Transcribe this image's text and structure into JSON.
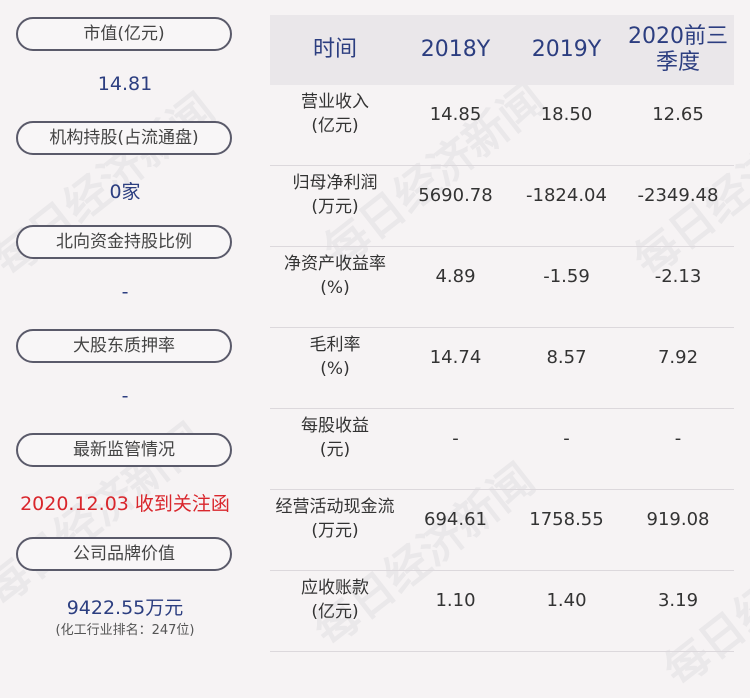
{
  "left_panel": {
    "items": [
      {
        "label": "市值(亿元)",
        "value": "14.81"
      },
      {
        "label": "机构持股(占流通盘)",
        "value": "0家"
      },
      {
        "label": "北向资金持股比例",
        "value": "-"
      },
      {
        "label": "大股东质押率",
        "value": "-"
      },
      {
        "label": "最新监管情况",
        "value": "2020.12.03 收到关注函"
      },
      {
        "label": "公司品牌价值",
        "value": "9422.55万元",
        "subvalue": "(化工行业排名：247位)"
      }
    ]
  },
  "table": {
    "headers": [
      "时间",
      "2018Y",
      "2019Y",
      "2020前三\n季度"
    ],
    "rows": [
      {
        "label": "营业收入\n(亿元)",
        "values": [
          "14.85",
          "18.50",
          "12.65"
        ]
      },
      {
        "label": "归母净利润\n(万元)",
        "values": [
          "5690.78",
          "-1824.04",
          "-2349.48"
        ]
      },
      {
        "label": "净资产收益率\n(%)",
        "values": [
          "4.89",
          "-1.59",
          "-2.13"
        ]
      },
      {
        "label": "毛利率\n(%)",
        "values": [
          "14.74",
          "8.57",
          "7.92"
        ]
      },
      {
        "label": "每股收益\n(元)",
        "values": [
          "-",
          "-",
          "-"
        ]
      },
      {
        "label": "经营活动现金流\n(万元)",
        "values": [
          "694.61",
          "1758.55",
          "919.08"
        ]
      },
      {
        "label": "应收账款\n(亿元)",
        "values": [
          "1.10",
          "1.40",
          "3.19"
        ]
      }
    ]
  },
  "watermark": {
    "text": "每日经济新闻"
  },
  "colors": {
    "accent": "#2c3e80",
    "alert": "#d9262c",
    "background": "#f6f3f4",
    "header_bg": "#eae7ea"
  }
}
